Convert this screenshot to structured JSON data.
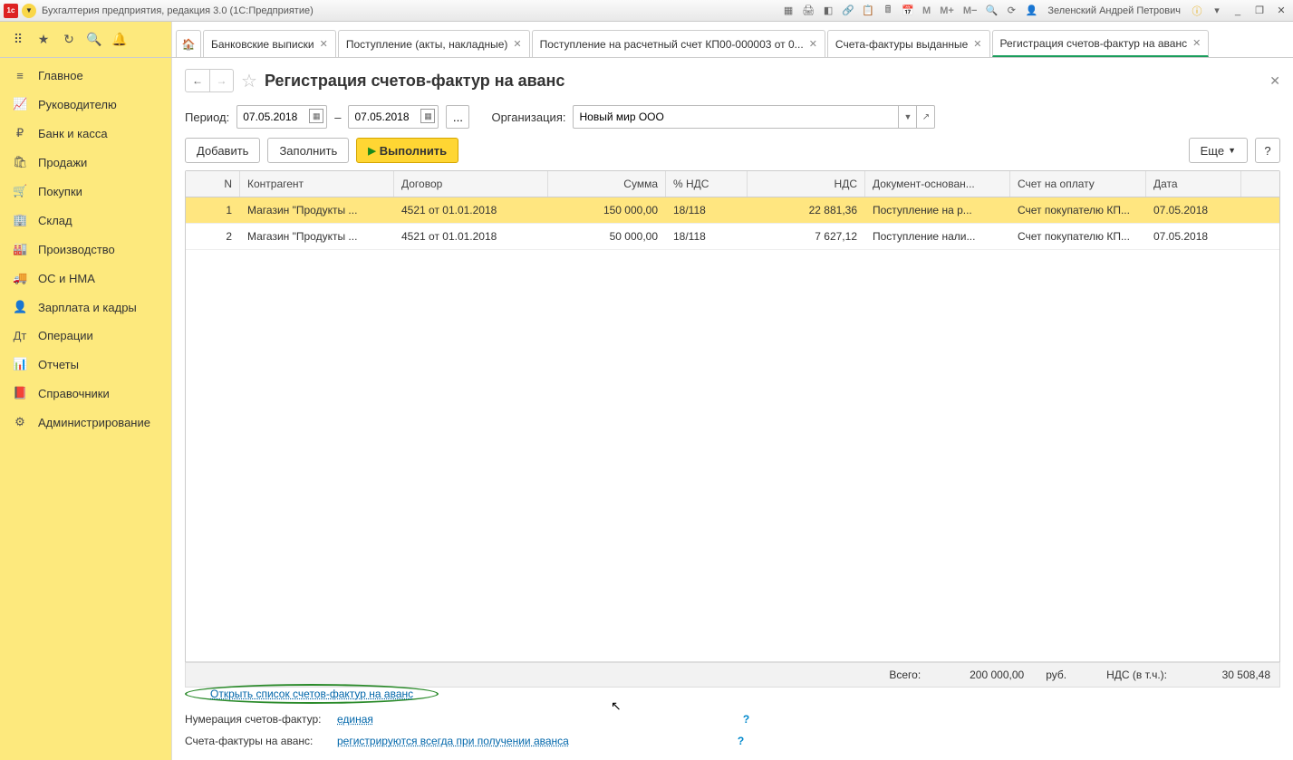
{
  "titlebar": {
    "app_title": "Бухгалтерия предприятия, редакция 3.0  (1С:Предприятие)",
    "user": "Зеленский Андрей Петрович",
    "m1": "M",
    "m2": "M+",
    "m3": "M−"
  },
  "tabs": [
    {
      "label": "Банковские выписки",
      "active": false
    },
    {
      "label": "Поступление (акты, накладные)",
      "active": false
    },
    {
      "label": "Поступление на расчетный счет КП00-000003 от 0...",
      "active": false
    },
    {
      "label": "Счета-фактуры выданные",
      "active": false
    },
    {
      "label": "Регистрация счетов-фактур на аванс",
      "active": true
    }
  ],
  "sidebar": {
    "items": [
      {
        "icon": "≡",
        "label": "Главное"
      },
      {
        "icon": "📈",
        "label": "Руководителю"
      },
      {
        "icon": "₽",
        "label": "Банк и касса"
      },
      {
        "icon": "🛍",
        "label": "Продажи"
      },
      {
        "icon": "🛒",
        "label": "Покупки"
      },
      {
        "icon": "🏢",
        "label": "Склад"
      },
      {
        "icon": "🏭",
        "label": "Производство"
      },
      {
        "icon": "🚚",
        "label": "ОС и НМА"
      },
      {
        "icon": "👤",
        "label": "Зарплата и кадры"
      },
      {
        "icon": "Дт",
        "label": "Операции"
      },
      {
        "icon": "📊",
        "label": "Отчеты"
      },
      {
        "icon": "📕",
        "label": "Справочники"
      },
      {
        "icon": "⚙",
        "label": "Администрирование"
      }
    ]
  },
  "page": {
    "title": "Регистрация счетов-фактур на аванс",
    "period_label": "Период:",
    "date_from": "07.05.2018",
    "date_to": "07.05.2018",
    "date_sep": "–",
    "org_label": "Организация:",
    "org_value": "Новый мир ООО",
    "btn_add": "Добавить",
    "btn_fill": "Заполнить",
    "btn_run": "Выполнить",
    "btn_more": "Еще",
    "btn_help": "?"
  },
  "table": {
    "headers": {
      "n": "N",
      "k": "Контрагент",
      "d": "Договор",
      "s": "Сумма",
      "p": "% НДС",
      "nds": "НДС",
      "doc": "Документ-основан...",
      "sch": "Счет на оплату",
      "dt": "Дата"
    },
    "rows": [
      {
        "n": "1",
        "k": "Магазин \"Продукты ...",
        "d": "4521 от 01.01.2018",
        "s": "150 000,00",
        "p": "18/118",
        "nds": "22 881,36",
        "doc": "Поступление на р...",
        "sch": "Счет покупателю КП...",
        "dt": "07.05.2018",
        "sel": true
      },
      {
        "n": "2",
        "k": "Магазин \"Продукты ...",
        "d": "4521 от 01.01.2018",
        "s": "50 000,00",
        "p": "18/118",
        "nds": "7 627,12",
        "doc": "Поступление нали...",
        "sch": "Счет покупателю КП...",
        "dt": "07.05.2018",
        "sel": false
      }
    ]
  },
  "footer": {
    "open_link": "Открыть список счетов-фактур на аванс",
    "num_label": "Нумерация счетов-фактур:",
    "num_link": "единая",
    "sf_label": "Счета-фактуры на аванс:",
    "sf_link": "регистрируются всегда при получении аванса",
    "total_label": "Всего:",
    "total_value": "200 000,00",
    "currency": "руб.",
    "nds_label": "НДС (в т.ч.):",
    "nds_value": "30 508,48"
  }
}
